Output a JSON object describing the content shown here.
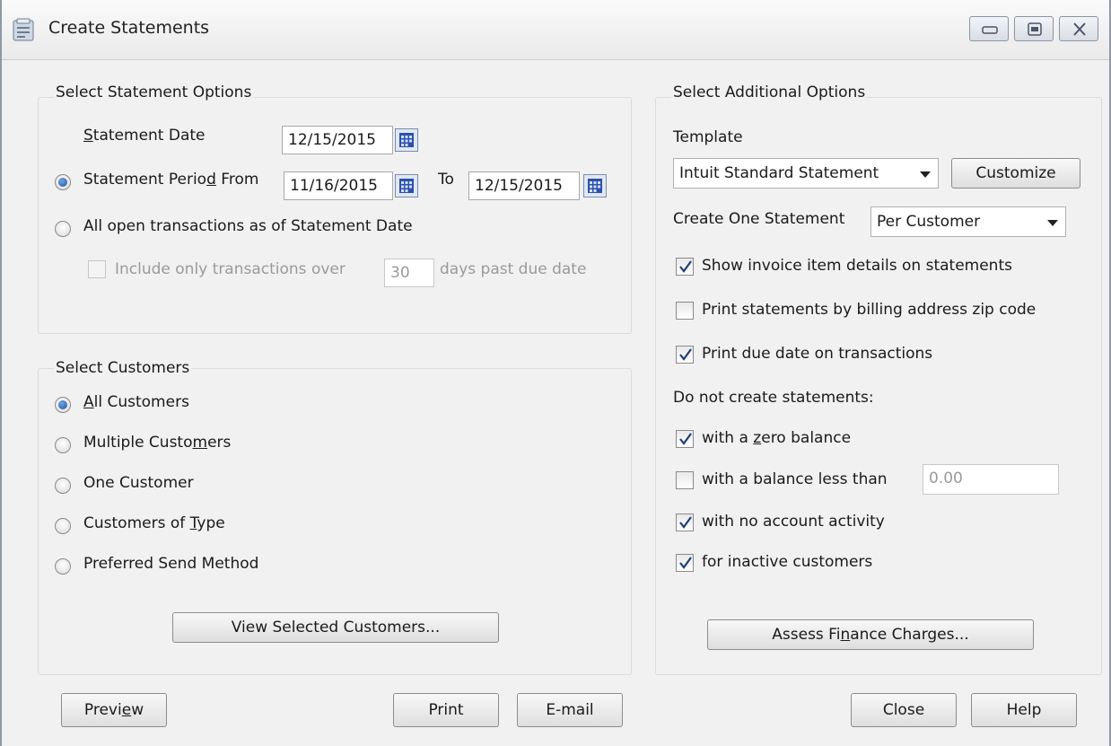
{
  "window": {
    "title": "Create Statements"
  },
  "options": {
    "group_title": "Select Statement Options",
    "statement_date_label": "Statement Date",
    "statement_date": "12/15/2015",
    "period_label": "Statement Period From",
    "period_from": "11/16/2015",
    "to_label": "To",
    "period_to": "12/15/2015",
    "period_selected": true,
    "all_open_label": "All open transactions as of Statement Date",
    "include_only_label": "Include only transactions over",
    "days_value": "30",
    "days_suffix": "days past due date"
  },
  "customers": {
    "group_title": "Select Customers",
    "choices": [
      "All Customers",
      "Multiple Customers",
      "One Customer",
      "Customers of Type",
      "Preferred Send Method"
    ],
    "selected": "All Customers",
    "view_button": "View Selected Customers..."
  },
  "additional": {
    "group_title": "Select Additional Options",
    "template_label": "Template",
    "template_value": "Intuit Standard Statement",
    "customize_button": "Customize",
    "create_one_label": "Create One Statement",
    "create_one_value": "Per Customer",
    "show_details_label": "Show invoice item details on statements",
    "show_details_checked": true,
    "print_zip_label": "Print statements by billing address zip code",
    "print_zip_checked": false,
    "print_due_label": "Print due date on transactions",
    "print_due_checked": true,
    "do_not_create_label": "Do not create statements:",
    "zero_balance_label": "with a zero balance",
    "zero_balance_checked": true,
    "balance_less_label": "with a balance less than",
    "balance_less_checked": false,
    "balance_less_value": "0.00",
    "no_activity_label": "with no account activity",
    "no_activity_checked": true,
    "inactive_label": "for inactive customers",
    "inactive_checked": true,
    "assess_button": "Assess Finance Charges..."
  },
  "footer": {
    "preview": "Preview",
    "print": "Print",
    "email": "E-mail",
    "close": "Close",
    "help": "Help"
  }
}
